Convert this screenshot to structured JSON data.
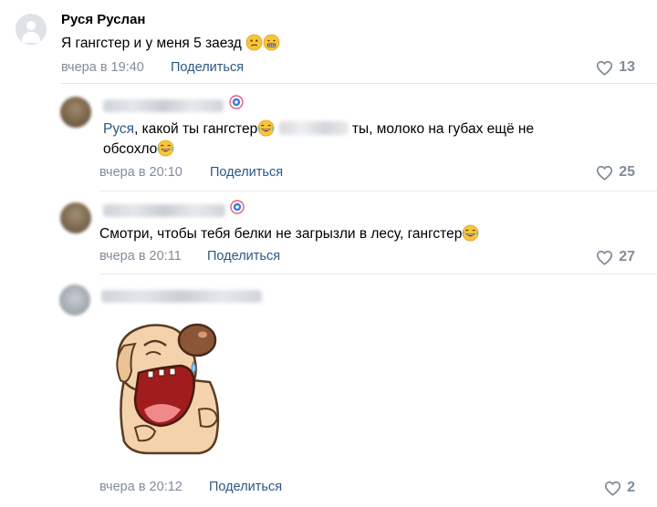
{
  "comments": [
    {
      "author": "Руся Руслан",
      "text": "Я гангстер и у меня 5 заезд",
      "time": "вчера в 19:40",
      "share": "Поделиться",
      "likes": "13"
    },
    {
      "mention": "Руся",
      "text_a": ", какой ты гангстер",
      "text_b": "ты, молоко на губах ещё не",
      "text_line2": "обсохло",
      "time": "вчера в 20:10",
      "share": "Поделиться",
      "likes": "25"
    },
    {
      "text": "Смотри, чтобы тебя белки не загрызли в лесу, гангстер",
      "time": "вчера в 20:11",
      "share": "Поделиться",
      "likes": "27"
    },
    {
      "sticker": "laughing-dog-sticker",
      "time": "вчера в 20:12",
      "share": "Поделиться",
      "likes": "2"
    }
  ],
  "icons": {
    "like": "heart-outline-icon",
    "emoji_neutral": "confused-face-emoji",
    "emoji_grimace": "grimacing-face-emoji",
    "emoji_laugh": "tears-of-joy-emoji",
    "badge": "profile-badge-icon"
  },
  "colors": {
    "link": "#2a5885",
    "meta": "#818c99",
    "divider": "#e7e8ec"
  }
}
